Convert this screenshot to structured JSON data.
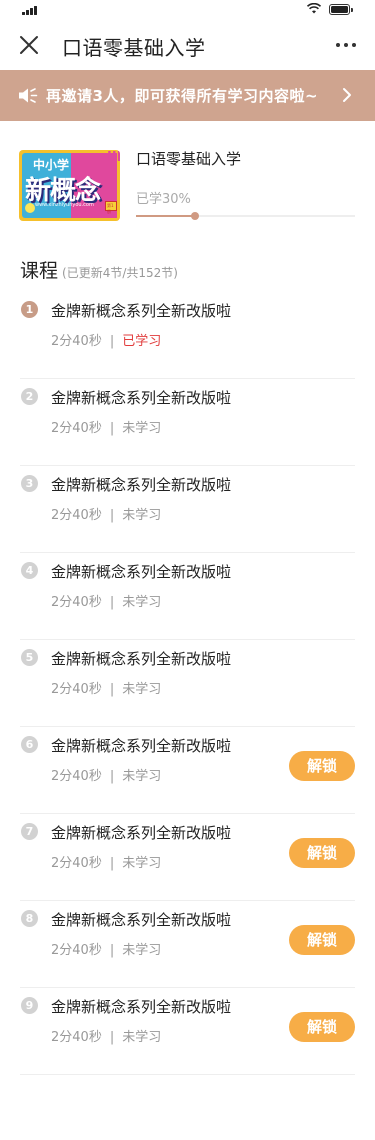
{
  "nav": {
    "title": "口语零基础入学",
    "close_icon": "close-icon",
    "more_icon": "more-dots-icon"
  },
  "invite": {
    "text": "再邀请3人，即可获得所有学习内容啦~",
    "icon": "speaker-icon",
    "arrow_icon": "chevron-right-icon",
    "color": "#cfa48f"
  },
  "course": {
    "title": "口语零基础入学",
    "progress_label": "已学30%",
    "progress": 0.27,
    "cover": {
      "tag": "中小学",
      "big": "新概念",
      "url": "www.xinzhiyunyou.com",
      "badge": "第1册",
      "lab": "III"
    }
  },
  "section": {
    "title": "课程",
    "subtitle": "(已更新4节/共152节)"
  },
  "lessons": [
    {
      "num": "1",
      "title": "金牌新概念系列全新改版啦",
      "duration": "2分40秒",
      "sep": "|",
      "status": "已学习",
      "learned": true,
      "locked": false
    },
    {
      "num": "2",
      "title": "金牌新概念系列全新改版啦",
      "duration": "2分40秒",
      "sep": "|",
      "status": "未学习",
      "learned": false,
      "locked": false
    },
    {
      "num": "3",
      "title": "金牌新概念系列全新改版啦",
      "duration": "2分40秒",
      "sep": "|",
      "status": "未学习",
      "learned": false,
      "locked": false
    },
    {
      "num": "4",
      "title": "金牌新概念系列全新改版啦",
      "duration": "2分40秒",
      "sep": "|",
      "status": "未学习",
      "learned": false,
      "locked": false
    },
    {
      "num": "5",
      "title": "金牌新概念系列全新改版啦",
      "duration": "2分40秒",
      "sep": "|",
      "status": "未学习",
      "learned": false,
      "locked": false
    },
    {
      "num": "6",
      "title": "金牌新概念系列全新改版啦",
      "duration": "2分40秒",
      "sep": "|",
      "status": "未学习",
      "learned": false,
      "locked": true
    },
    {
      "num": "7",
      "title": "金牌新概念系列全新改版啦",
      "duration": "2分40秒",
      "sep": "|",
      "status": "未学习",
      "learned": false,
      "locked": true
    },
    {
      "num": "8",
      "title": "金牌新概念系列全新改版啦",
      "duration": "2分40秒",
      "sep": "|",
      "status": "未学习",
      "learned": false,
      "locked": true
    },
    {
      "num": "9",
      "title": "金牌新概念系列全新改版啦",
      "duration": "2分40秒",
      "sep": "|",
      "status": "未学习",
      "learned": false,
      "locked": true
    }
  ],
  "unlock_label": "解锁",
  "colors": {
    "accent": "#cfa48f",
    "unlock": "#f7ad47",
    "learned": "#e13c3c"
  }
}
